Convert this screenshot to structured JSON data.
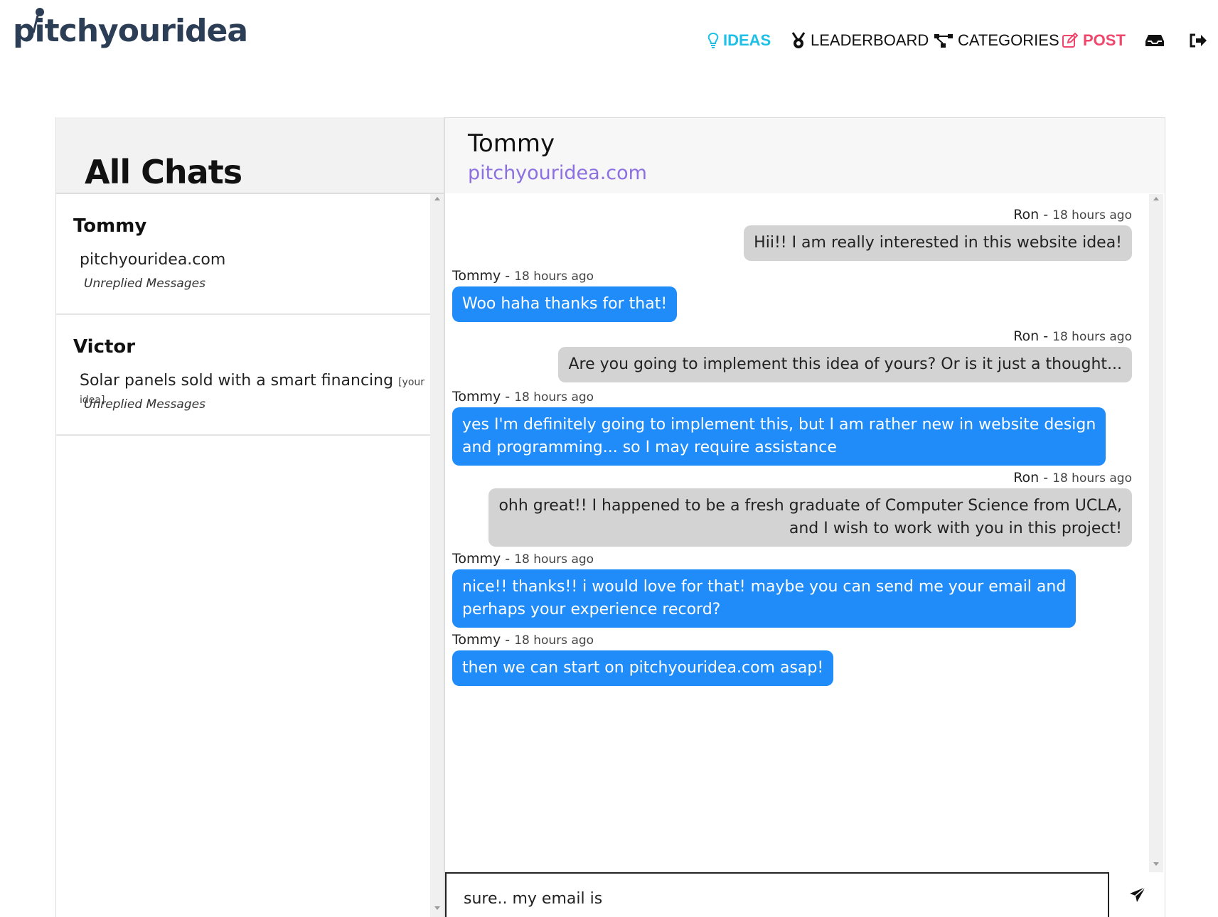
{
  "brand": {
    "logo_text": "pitchyouridea"
  },
  "nav": {
    "ideas": "IDEAS",
    "leaderboard": "LEADERBOARD",
    "categories": "CATEGORIES",
    "post": "POST",
    "inbox_icon": "inbox-icon",
    "logout_icon": "logout-icon",
    "colors": {
      "ideas": "#1ec0e8",
      "post": "#f0466c"
    }
  },
  "sidebar": {
    "title": "All Chats",
    "chats": [
      {
        "name": "Tommy",
        "idea": "pitchyouridea.com",
        "tag": "",
        "status": "Unreplied Messages"
      },
      {
        "name": "Victor",
        "idea": "Solar panels sold with a smart financing",
        "tag": "[your idea]",
        "status": "Unreplied Messages"
      }
    ]
  },
  "conversation": {
    "name": "Tommy",
    "idea": "pitchyouridea.com",
    "messages": [
      {
        "sender": "Ron",
        "time": "18 hours ago",
        "text": "Hii!! I am really interested in this website idea!",
        "direction": "out"
      },
      {
        "sender": "Tommy",
        "time": "18 hours ago",
        "text": "Woo haha thanks for that!",
        "direction": "in"
      },
      {
        "sender": "Ron",
        "time": "18 hours ago",
        "text": "Are you going to implement this idea of yours? Or is it just a thought...",
        "direction": "out"
      },
      {
        "sender": "Tommy",
        "time": "18 hours ago",
        "text_line1": "yes I'm definitely going to implement this, but I am rather new in website design",
        "text_line2": "and programming... so I may require assistance",
        "direction": "in"
      },
      {
        "sender": "Ron",
        "time": "18 hours ago",
        "text_line1": "ohh great!! I happened to be a fresh graduate of Computer Science from UCLA,",
        "text_line2": "and I wish to work with you in this project!",
        "direction": "out"
      },
      {
        "sender": "Tommy",
        "time": "18 hours ago",
        "text_line1": "nice!! thanks!! i would love for that! maybe you can send me your email and",
        "text_line2": "perhaps your experience record?",
        "direction": "in"
      },
      {
        "sender": "Tommy",
        "time": "18 hours ago",
        "text": "then we can start on pitchyouridea.com asap!",
        "direction": "in"
      }
    ],
    "composer_value": "sure.. my email is ",
    "send_icon": "send-icon",
    "colors": {
      "incoming": "#1f8cf9",
      "outgoing": "#d3d3d3"
    }
  }
}
